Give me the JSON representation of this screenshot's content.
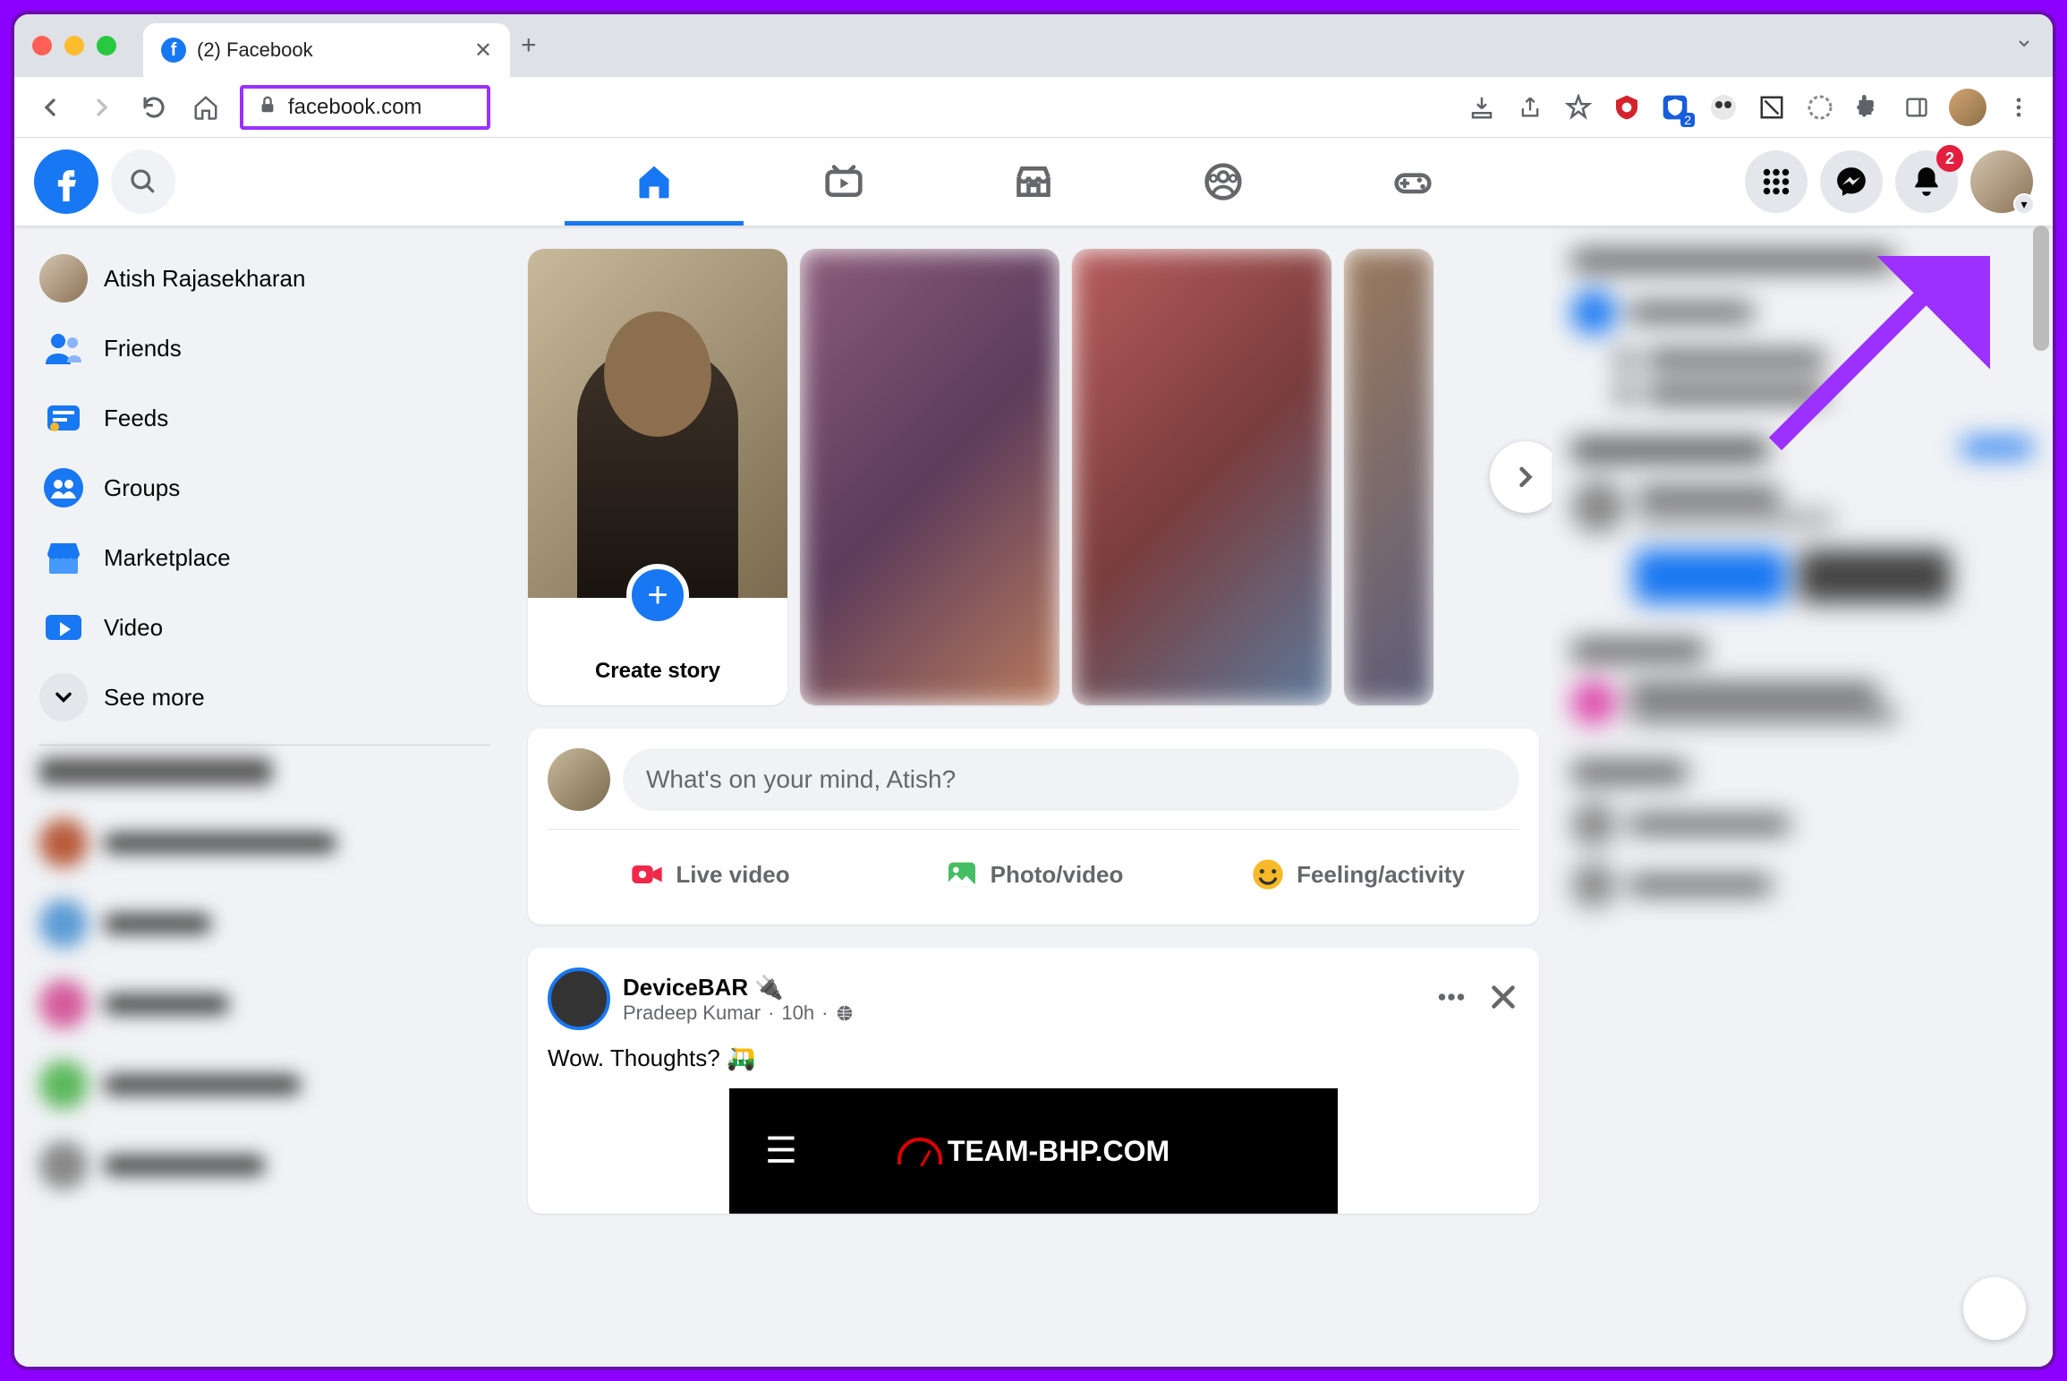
{
  "tab": {
    "title": "(2) Facebook"
  },
  "url": "facebook.com",
  "fb": {
    "notifications_badge": "2",
    "sidebar": {
      "profile": "Atish Rajasekharan",
      "items": [
        {
          "icon": "friends",
          "label": "Friends"
        },
        {
          "icon": "feeds",
          "label": "Feeds"
        },
        {
          "icon": "groups",
          "label": "Groups"
        },
        {
          "icon": "marketplace",
          "label": "Marketplace"
        },
        {
          "icon": "video",
          "label": "Video"
        }
      ],
      "see_more": "See more"
    },
    "stories": {
      "create_label": "Create story"
    },
    "composer": {
      "placeholder": "What's on your mind, Atish?",
      "live": "Live video",
      "photo": "Photo/video",
      "feeling": "Feeling/activity"
    },
    "post": {
      "page": "DeviceBAR 🔌",
      "author": "Pradeep Kumar",
      "time": "10h",
      "text": "Wow. Thoughts? 🛺",
      "logo": "TEAM-BHP.COM"
    }
  }
}
